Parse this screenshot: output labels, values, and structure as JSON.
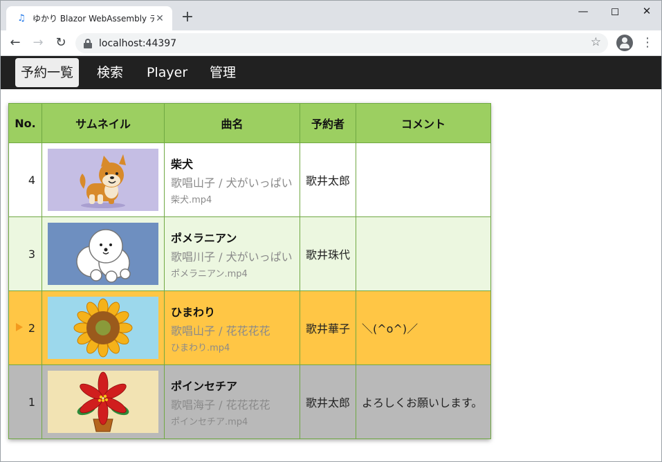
{
  "browser": {
    "tab_title": "ゆかり Blazor WebAssembly デモ",
    "url": "localhost:44397"
  },
  "nav": {
    "items": [
      "予約一覧",
      "検索",
      "Player",
      "管理"
    ],
    "active_index": 0
  },
  "table": {
    "headers": [
      "No.",
      "サムネイル",
      "曲名",
      "予約者",
      "コメント"
    ],
    "rows": [
      {
        "no": "4",
        "title": "柴犬",
        "artist": "歌唱山子 / 犬がいっぱい",
        "file": "柴犬.mp4",
        "singer": "歌井太郎",
        "comment": "",
        "thumb_bg": "#c5bee4",
        "thumb_icon": "shiba-dog-icon",
        "playing": false
      },
      {
        "no": "3",
        "title": "ポメラニアン",
        "artist": "歌唱川子 / 犬がいっぱい",
        "file": "ポメラニアン.mp4",
        "singer": "歌井珠代",
        "comment": "",
        "thumb_bg": "#6e8fc0",
        "thumb_icon": "pomeranian-dog-icon",
        "playing": false
      },
      {
        "no": "2",
        "title": "ひまわり",
        "artist": "歌唱山子 / 花花花花",
        "file": "ひまわり.mp4",
        "singer": "歌井華子",
        "comment": "＼(^o^)／",
        "thumb_bg": "#9cd8ec",
        "thumb_icon": "sunflower-icon",
        "playing": true
      },
      {
        "no": "1",
        "title": "ポインセチア",
        "artist": "歌唱海子 / 花花花花",
        "file": "ポインセチア.mp4",
        "singer": "歌井太郎",
        "comment": "よろしくお願いします。",
        "thumb_bg": "#f2e3b3",
        "thumb_icon": "poinsettia-icon",
        "playing": false
      }
    ]
  },
  "colors": {
    "header_green": "#9ccf61",
    "row_green": "#ecf7e0",
    "row_playing": "#ffc645",
    "row_gray": "#b9b9b9",
    "playing_marker": "#f39a1e",
    "navbar": "#212121"
  }
}
